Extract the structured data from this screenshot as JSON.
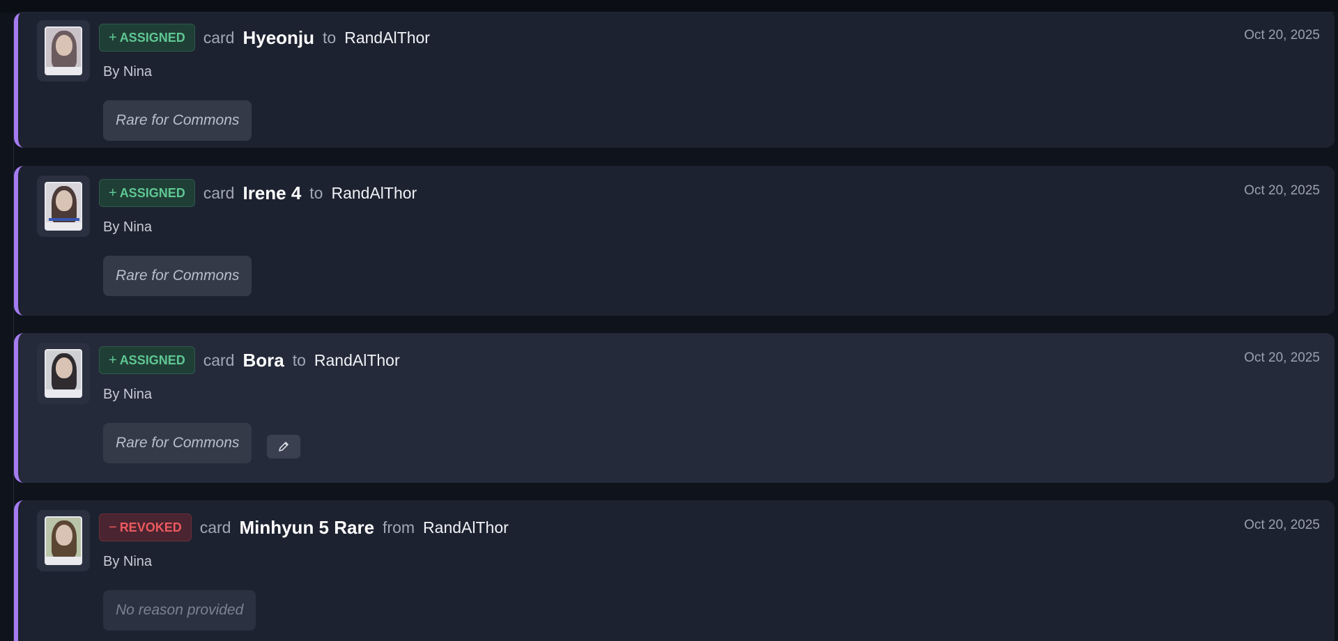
{
  "entries": [
    {
      "action": "ASSIGNED",
      "action_sign": "+",
      "word_card": "card",
      "card_name": "Hyeonju",
      "preposition": "to",
      "target_user": "RandAlThor",
      "byline": "By Nina",
      "date": "Oct 20, 2025",
      "reason": "Rare for Commons"
    },
    {
      "action": "ASSIGNED",
      "action_sign": "+",
      "word_card": "card",
      "card_name": "Irene 4",
      "preposition": "to",
      "target_user": "RandAlThor",
      "byline": "By Nina",
      "date": "Oct 20, 2025",
      "reason": "Rare for Commons"
    },
    {
      "action": "ASSIGNED",
      "action_sign": "+",
      "word_card": "card",
      "card_name": "Bora",
      "preposition": "to",
      "target_user": "RandAlThor",
      "byline": "By Nina",
      "date": "Oct 20, 2025",
      "reason": "Rare for Commons",
      "edit_icon": "pencil-icon"
    },
    {
      "action": "REVOKED",
      "action_sign": "−",
      "word_card": "card",
      "card_name": "Minhyun 5 Rare",
      "preposition": "from",
      "target_user": "RandAlThor",
      "byline": "By Nina",
      "date": "Oct 20, 2025",
      "reason": "No reason provided"
    }
  ],
  "colors": {
    "accent": "#a57cf0",
    "assigned": "#5fc793",
    "revoked": "#ea5a5e"
  }
}
